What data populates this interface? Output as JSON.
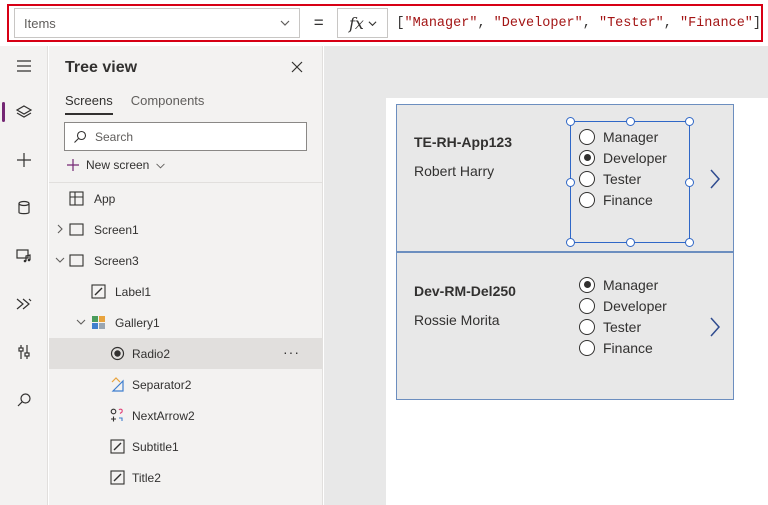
{
  "formula_bar": {
    "property": "Items",
    "equals": "=",
    "fx": "fx",
    "formula": {
      "open": "[",
      "items": [
        "\"Manager\"",
        "\"Developer\"",
        "\"Tester\"",
        "\"Finance\""
      ],
      "sep": ", ",
      "close": "]"
    }
  },
  "tree_view": {
    "title": "Tree view",
    "tabs": [
      {
        "label": "Screens",
        "active": true
      },
      {
        "label": "Components",
        "active": false
      }
    ],
    "search_placeholder": "Search",
    "new_screen_label": "New screen",
    "nodes": [
      {
        "label": "App",
        "icon": "app-icon"
      },
      {
        "label": "Screen1",
        "icon": "screen-icon",
        "expander": "collapsed"
      },
      {
        "label": "Screen3",
        "icon": "screen-icon",
        "expander": "expanded"
      },
      {
        "label": "Label1",
        "icon": "label-icon"
      },
      {
        "label": "Gallery1",
        "icon": "gallery-icon",
        "expander": "expanded"
      },
      {
        "label": "Radio2",
        "icon": "radio-icon",
        "selected": true,
        "more": "···"
      },
      {
        "label": "Separator2",
        "icon": "separator-icon"
      },
      {
        "label": "NextArrow2",
        "icon": "next-arrow-icon"
      },
      {
        "label": "Subtitle1",
        "icon": "label-icon"
      },
      {
        "label": "Title2",
        "icon": "label-icon"
      }
    ]
  },
  "gallery": {
    "items": [
      {
        "title": "TE-RH-App123",
        "subtitle": "Robert Harry",
        "options": [
          "Manager",
          "Developer",
          "Tester",
          "Finance"
        ],
        "selected_option": "Developer"
      },
      {
        "title": "Dev-RM-Del250",
        "subtitle": "Rossie Morita",
        "options": [
          "Manager",
          "Developer",
          "Tester",
          "Finance"
        ],
        "selected_option": "Manager"
      }
    ]
  },
  "colors": {
    "accent": "#742774",
    "selection": "#2f67c7",
    "formula_highlight": "#d70015"
  }
}
